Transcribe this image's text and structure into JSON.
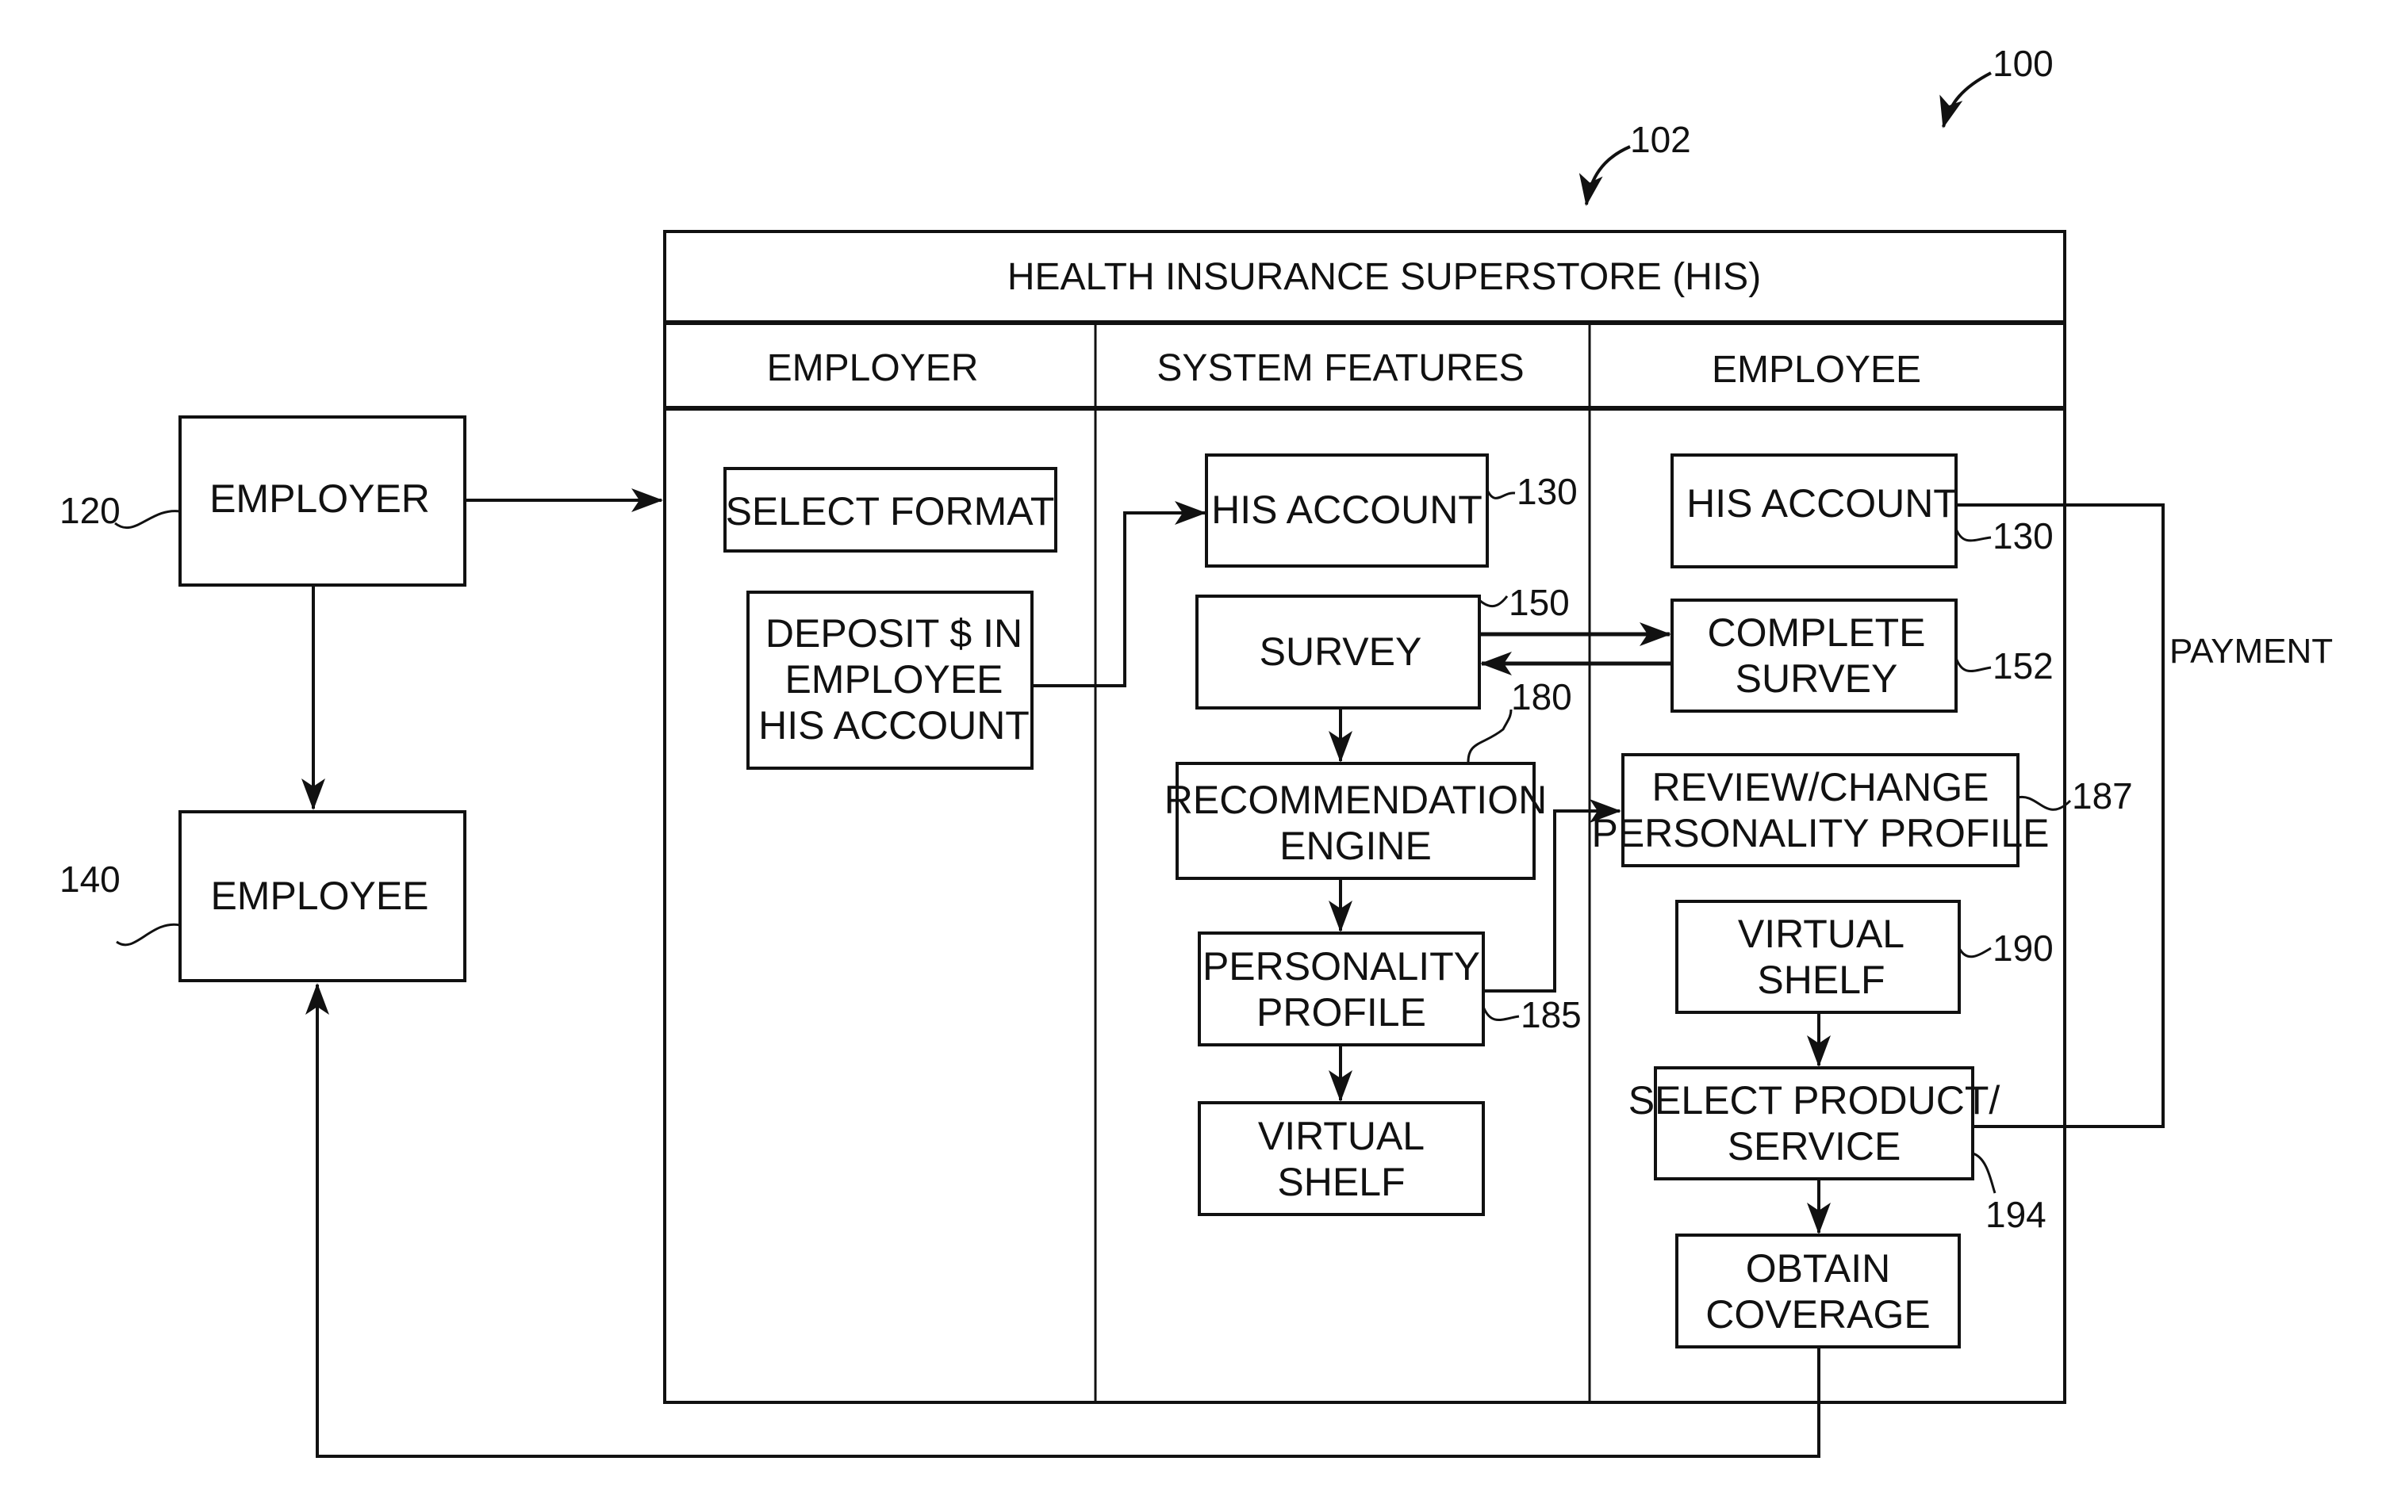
{
  "figure": {
    "ref_system": "100",
    "ref_superstore": "102"
  },
  "superstore": {
    "title": "HEALTH INSURANCE SUPERSTORE (HIS)",
    "columns": [
      "EMPLOYER",
      "SYSTEM FEATURES",
      "EMPLOYEE"
    ]
  },
  "external": {
    "employer": {
      "label": "EMPLOYER",
      "ref": "120"
    },
    "employee": {
      "label": "EMPLOYEE",
      "ref": "140"
    }
  },
  "employer_col": {
    "select_format": "SELECT FORMAT",
    "deposit": [
      "DEPOSIT $ IN",
      "EMPLOYEE",
      "HIS ACCOUNT"
    ]
  },
  "system_col": {
    "his_account": {
      "label": "HIS ACCOUNT",
      "ref": "130"
    },
    "survey": {
      "label": "SURVEY",
      "ref": "150"
    },
    "recommendation": {
      "lines": [
        "RECOMMENDATION",
        "ENGINE"
      ],
      "ref": "180"
    },
    "personality": {
      "lines": [
        "PERSONALITY",
        "PROFILE"
      ],
      "ref": "185"
    },
    "virtual_shelf": {
      "lines": [
        "VIRTUAL",
        "SHELF"
      ]
    }
  },
  "employee_col": {
    "his_account": {
      "label": "HIS ACCOUNT",
      "ref": "130"
    },
    "complete_survey": {
      "lines": [
        "COMPLETE",
        "SURVEY"
      ],
      "ref": "152"
    },
    "review_profile": {
      "lines": [
        "REVIEW/CHANGE",
        "PERSONALITY PROFILE"
      ],
      "ref": "187"
    },
    "virtual_shelf": {
      "lines": [
        "VIRTUAL",
        "SHELF"
      ],
      "ref": "190"
    },
    "select_product": {
      "lines": [
        "SELECT PRODUCT/",
        "SERVICE"
      ],
      "ref": "194"
    },
    "obtain_coverage": {
      "lines": [
        "OBTAIN",
        "COVERAGE"
      ]
    }
  },
  "payment_label": "PAYMENT"
}
